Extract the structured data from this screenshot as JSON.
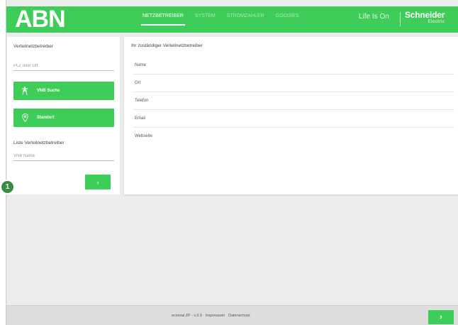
{
  "header": {
    "logo": "ABN",
    "nav": [
      {
        "label": "NETZBETREIBER",
        "active": true
      },
      {
        "label": "SYSTEM",
        "active": false
      },
      {
        "label": "STROMZAHLER",
        "active": false
      },
      {
        "label": "GOODIES",
        "active": false
      }
    ],
    "tagline": "Life Is On",
    "brand": "Schneider",
    "brand_sub": "Electric"
  },
  "left_panel": {
    "heading": "Verteilnetzbetreiber",
    "plz_placeholder": "PLZ oder Ort",
    "vnb_search_label": "VNB Suche",
    "vnb_search_icon": "transmission-tower-icon",
    "location_label": "Standort",
    "location_icon": "location-pin-icon",
    "list_heading": "Liste Verteilnetzbetreiber",
    "vnb_name_placeholder": "VNB Name",
    "next_label": "›"
  },
  "right_panel": {
    "title": "Ihr zuständiger Verteilnetzbetreiber",
    "rows": [
      {
        "label": "Name"
      },
      {
        "label": "Ort"
      },
      {
        "label": "Telefon"
      },
      {
        "label": "Email"
      },
      {
        "label": "Webseite"
      }
    ]
  },
  "marker": {
    "label": "1"
  },
  "footer": {
    "version": "ecoreal ZP - v.3.9",
    "impressum": "Impressum",
    "datenschutz": "Datenschutz",
    "next_label": "›"
  },
  "colors": {
    "accent": "#3dcd58",
    "background": "#ececec",
    "marker": "#3b8a44"
  }
}
